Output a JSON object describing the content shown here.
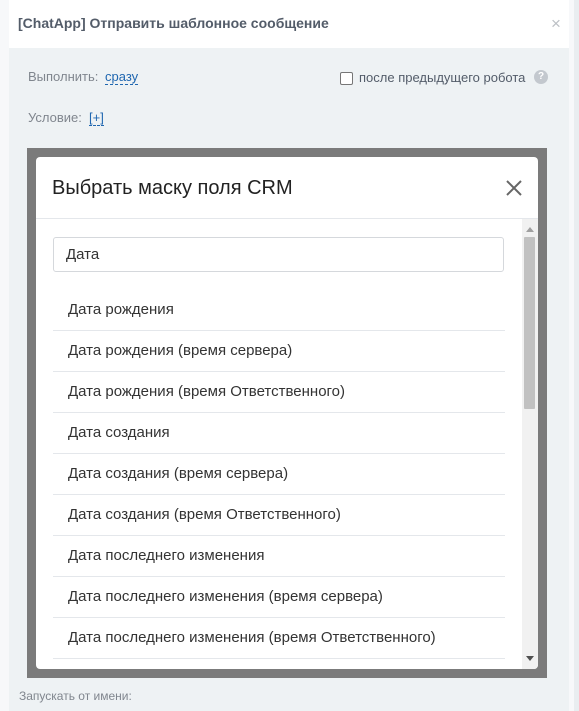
{
  "dialog": {
    "title": "[ChatApp] Отправить шаблонное сообщение",
    "close": "×",
    "run_label": "Выполнить:",
    "run_value": "сразу",
    "after_prev_label": "после предыдущего робота",
    "help": "?",
    "condition_label": "Условие:",
    "condition_value": "[+]",
    "run_as_label": "Запускать от имени:"
  },
  "modal": {
    "title": "Выбрать маску поля CRM",
    "search_value": "Дата",
    "items": [
      "Дата рождения",
      "Дата рождения (время сервера)",
      "Дата рождения (время Ответственного)",
      "Дата создания",
      "Дата создания (время сервера)",
      "Дата создания (время Ответственного)",
      "Дата последнего изменения",
      "Дата последнего изменения (время сервера)",
      "Дата последнего изменения (время Ответственного)"
    ]
  }
}
